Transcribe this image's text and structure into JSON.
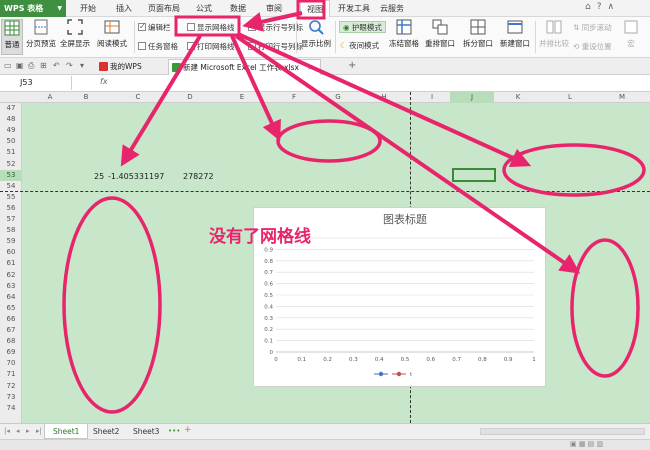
{
  "app": {
    "name": "WPS 表格",
    "menu": [
      "开始",
      "插入",
      "页面布局",
      "公式",
      "数据",
      "审阅",
      "视图",
      "开发工具",
      "云服务"
    ],
    "active_menu": "视图"
  },
  "ribbon": {
    "normal": "普通",
    "page_break": "分页预览",
    "fullscreen": "全屏显示",
    "reading": "阅读模式",
    "edit_bar": "编辑栏",
    "show_gridlines": "显示网格线",
    "show_row_col": "显示行号列标",
    "task_pane": "任务窗格",
    "print_gridlines": "打印网格线",
    "print_row_col": "打印行号列标",
    "zoom": "显示比例",
    "eye_protect": "护眼模式",
    "night_mode": "夜间模式",
    "freeze": "冻结窗格",
    "rearrange": "重排窗口",
    "split": "拆分窗口",
    "new_window": "新建窗口",
    "side_by_side": "并排比较",
    "sync_scroll": "同步滚动",
    "reset_position": "重设位置",
    "macro": "宏"
  },
  "tabs": {
    "my_wps": "我的WPS",
    "doc": "新建 Microsoft Excel 工作表.xlsx",
    "add": "+"
  },
  "formula": {
    "cell_ref": "J53",
    "fx": "fx"
  },
  "columns": [
    "A",
    "B",
    "C",
    "D",
    "E",
    "F",
    "G",
    "H",
    "I",
    "J",
    "K",
    "L",
    "M"
  ],
  "rows": [
    "47",
    "48",
    "49",
    "50",
    "51",
    "52",
    "53",
    "54",
    "55",
    "56",
    "57",
    "58",
    "59",
    "60",
    "61",
    "62",
    "63",
    "64",
    "65",
    "66",
    "67",
    "68",
    "69",
    "70",
    "71",
    "72",
    "73",
    "74"
  ],
  "selected_row": "53",
  "selected_col": "J",
  "cells": {
    "b53": "25",
    "c53": "-1.405331197",
    "d53": "278272"
  },
  "annotation": {
    "text": "没有了网格线"
  },
  "chart_data": {
    "type": "scatter",
    "title": "图表标题",
    "xlim": [
      0,
      1
    ],
    "ylim": [
      0,
      1
    ],
    "xticks": [
      "0",
      "0.1",
      "0.2",
      "0.3",
      "0.4",
      "0.5",
      "0.6",
      "0.7",
      "0.8",
      "0.9",
      "1"
    ],
    "yticks": [
      "0",
      "0.1",
      "0.2",
      "0.3",
      "0.4",
      "0.5",
      "0.6",
      "0.7",
      "0.8",
      "0.9",
      "1"
    ],
    "series": [
      {
        "name": "",
        "color": "#4472c4",
        "values": []
      },
      {
        "name": "t",
        "color": "#c0504d",
        "values": []
      }
    ],
    "legend": "bottom",
    "grid": true
  },
  "sheets": [
    "Sheet1",
    "Sheet2",
    "Sheet3"
  ],
  "active_sheet": "Sheet1"
}
